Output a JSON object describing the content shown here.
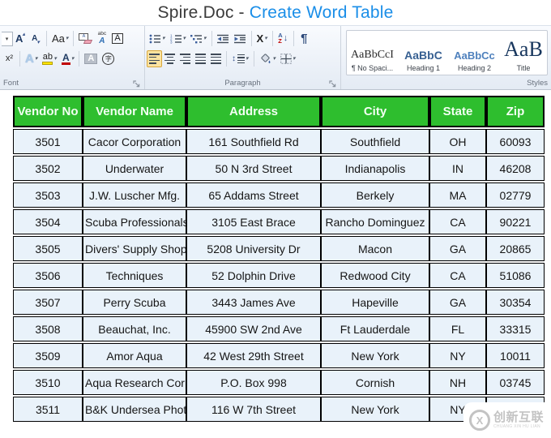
{
  "title": {
    "prefix": "Spire.Doc -",
    "highlight": "Create Word Table"
  },
  "colors": {
    "accent_blue": "#1a8ee8",
    "table_header_green": "#2ebe2e",
    "table_row_blue": "#e9f2fa",
    "selected_button_orange": "#fbe3a1"
  },
  "ribbon": {
    "groups": {
      "font_label": "Font",
      "paragraph_label": "Paragraph",
      "styles_label": "Styles"
    },
    "glyphs": {
      "dropdown": "▾",
      "grow_font": "A",
      "grow_font_mark": "▴",
      "shrink_font": "A",
      "shrink_font_mark": "▾",
      "change_case": "Aa",
      "clear_formatting": "A",
      "phonetic_top": "abc",
      "phonetic_base": "A",
      "char_border": "A",
      "superscript": "x²",
      "text_effects": "A",
      "highlight": "ab",
      "font_color": "A",
      "char_shade": "A",
      "enclose": "字",
      "asian_layout": "X",
      "sort_a": "A",
      "sort_z": "Z",
      "pilcrow": "¶",
      "line_spacing_arrow": "↕"
    },
    "styles_gallery": {
      "items": [
        {
          "preview": "AaBbCcI",
          "label": "¶ No Spaci..."
        },
        {
          "preview": "AaBbC",
          "label": "Heading 1"
        },
        {
          "preview": "AaBbCc",
          "label": "Heading 2"
        },
        {
          "preview": "AaB",
          "label": "Title"
        }
      ]
    }
  },
  "table": {
    "headers": [
      "Vendor No",
      "Vendor Name",
      "Address",
      "City",
      "State",
      "Zip"
    ],
    "rows": [
      [
        "3501",
        "Cacor Corporation",
        "161 Southfield Rd",
        "Southfield",
        "OH",
        "60093"
      ],
      [
        "3502",
        "Underwater",
        "50 N 3rd Street",
        "Indianapolis",
        "IN",
        "46208"
      ],
      [
        "3503",
        "J.W.  Luscher Mfg.",
        "65 Addams Street",
        "Berkely",
        "MA",
        "02779"
      ],
      [
        "3504",
        "Scuba Professionals",
        "3105 East Brace",
        "Rancho Dominguez",
        "CA",
        "90221"
      ],
      [
        "3505",
        "Divers'  Supply Shop",
        "5208 University Dr",
        "Macon",
        "GA",
        "20865"
      ],
      [
        "3506",
        "Techniques",
        "52 Dolphin Drive",
        "Redwood City",
        "CA",
        "51086"
      ],
      [
        "3507",
        "Perry Scuba",
        "3443 James Ave",
        "Hapeville",
        "GA",
        "30354"
      ],
      [
        "3508",
        "Beauchat, Inc.",
        "45900 SW 2nd Ave",
        "Ft Lauderdale",
        "FL",
        "33315"
      ],
      [
        "3509",
        "Amor Aqua",
        "42 West 29th Street",
        "New York",
        "NY",
        "10011"
      ],
      [
        "3510",
        "Aqua Research Corp.",
        "P.O. Box 998",
        "Cornish",
        "NH",
        "03745"
      ],
      [
        "3511",
        "B&K Undersea Photo",
        "116 W 7th Street",
        "New York",
        "NY",
        ""
      ]
    ]
  },
  "watermark": {
    "mark": "X",
    "cn": "创新互联",
    "en": "CHUANG XIN HU LIAN"
  }
}
